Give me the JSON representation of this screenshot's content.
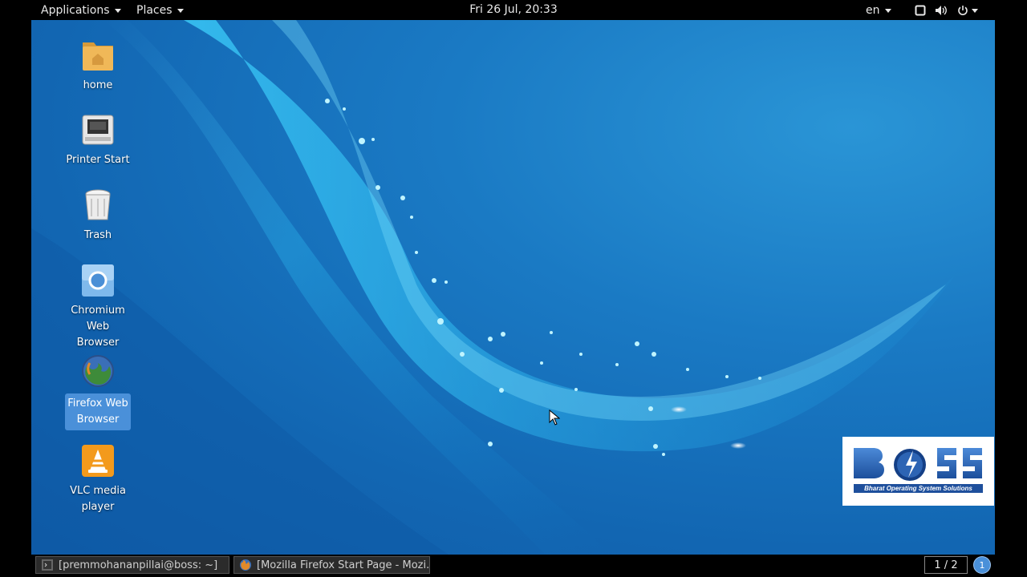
{
  "top_panel": {
    "applications_label": "Applications",
    "places_label": "Places",
    "clock": "Fri 26 Jul, 20:33",
    "language": "en",
    "icons": [
      "screen-icon",
      "volume-icon",
      "power-icon"
    ]
  },
  "desktop_icons": [
    {
      "name": "home",
      "icon": "folder-icon",
      "label": "home",
      "selected": false
    },
    {
      "name": "printer-start",
      "icon": "printer-icon",
      "label": "Printer Start",
      "selected": false
    },
    {
      "name": "trash",
      "icon": "trash-icon",
      "label": "Trash",
      "selected": false
    },
    {
      "name": "chromium",
      "icon": "chromium-icon",
      "label_line1": "Chromium Web",
      "label_line2": "Browser",
      "selected": false
    },
    {
      "name": "firefox",
      "icon": "firefox-icon",
      "label_line1": "Firefox Web",
      "label_line2": "Browser",
      "selected": true
    },
    {
      "name": "vlc",
      "icon": "vlc-icon",
      "label": "VLC media player",
      "selected": false
    }
  ],
  "logo": {
    "text": "BOSS",
    "tagline": "Bharat Operating System Solutions"
  },
  "taskbar": {
    "tasks": [
      {
        "label": "[premmohananpillai@boss: ~]",
        "icon": "terminal-icon"
      },
      {
        "label": "[Mozilla Firefox Start Page - Mozi...",
        "icon": "firefox-icon"
      }
    ],
    "workspace": "1 / 2",
    "notification_count": "1"
  },
  "colors": {
    "desktop_blue": "#1a7ac4",
    "selection": "#4a90d9",
    "panel": "#000000"
  }
}
